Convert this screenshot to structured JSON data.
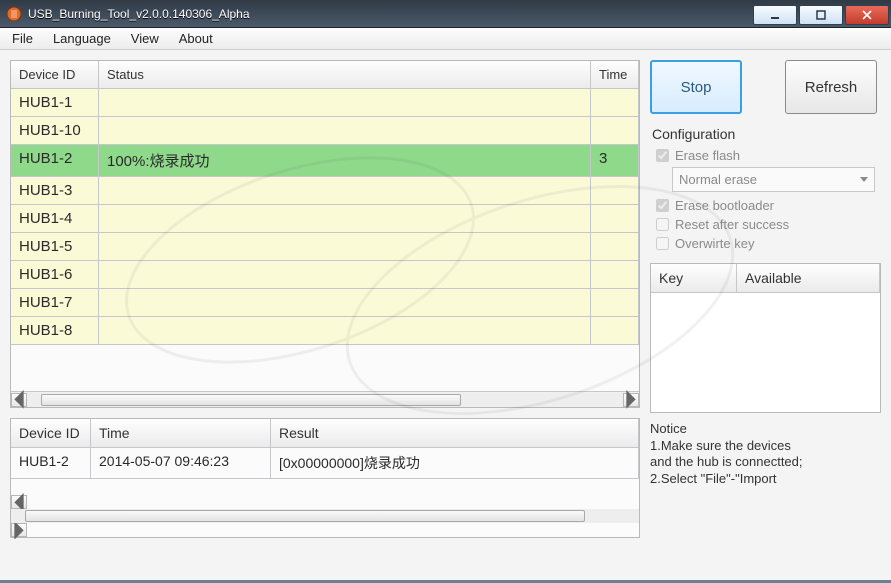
{
  "window": {
    "title": "USB_Burning_Tool_v2.0.0.140306_Alpha"
  },
  "menu": {
    "file": "File",
    "language": "Language",
    "view": "View",
    "about": "About"
  },
  "device_table": {
    "headers": {
      "id": "Device ID",
      "status": "Status",
      "time": "Time"
    },
    "rows": [
      {
        "id": "HUB1-1",
        "status": "",
        "time": "",
        "success": false
      },
      {
        "id": "HUB1-10",
        "status": "",
        "time": "",
        "success": false
      },
      {
        "id": "HUB1-2",
        "status": "100%:烧录成功",
        "time": "3",
        "success": true
      },
      {
        "id": "HUB1-3",
        "status": "",
        "time": "",
        "success": false
      },
      {
        "id": "HUB1-4",
        "status": "",
        "time": "",
        "success": false
      },
      {
        "id": "HUB1-5",
        "status": "",
        "time": "",
        "success": false
      },
      {
        "id": "HUB1-6",
        "status": "",
        "time": "",
        "success": false
      },
      {
        "id": "HUB1-7",
        "status": "",
        "time": "",
        "success": false
      },
      {
        "id": "HUB1-8",
        "status": "",
        "time": "",
        "success": false
      }
    ]
  },
  "log_table": {
    "headers": {
      "id": "Device ID",
      "time": "Time",
      "result": "Result"
    },
    "rows": [
      {
        "id": "HUB1-2",
        "time": "2014-05-07 09:46:23",
        "result": "[0x00000000]烧录成功"
      }
    ]
  },
  "buttons": {
    "stop": "Stop",
    "refresh": "Refresh"
  },
  "config": {
    "title": "Configuration",
    "erase_flash": {
      "label": "Erase flash",
      "checked": true
    },
    "erase_mode": {
      "selected": "Normal erase"
    },
    "erase_bootloader": {
      "label": "Erase bootloader",
      "checked": true
    },
    "reset_after": {
      "label": "Reset after success",
      "checked": false
    },
    "overwrite_key": {
      "label": "Overwirte key",
      "checked": false
    }
  },
  "key_table": {
    "headers": {
      "key": "Key",
      "available": "Available"
    }
  },
  "notice": {
    "title": "Notice",
    "line1": "1.Make sure the devices",
    "line2": "and the hub is connectted;",
    "line3": "2.Select \"File\"-\"Import"
  }
}
